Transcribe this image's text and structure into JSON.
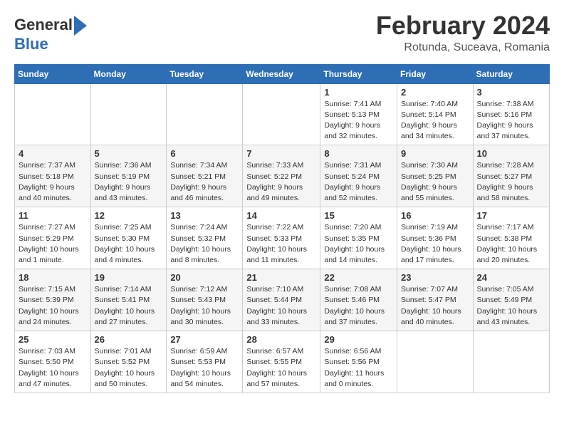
{
  "header": {
    "logo_general": "General",
    "logo_blue": "Blue",
    "month_title": "February 2024",
    "location": "Rotunda, Suceava, Romania"
  },
  "weekdays": [
    "Sunday",
    "Monday",
    "Tuesday",
    "Wednesday",
    "Thursday",
    "Friday",
    "Saturday"
  ],
  "weeks": [
    [
      {
        "day": "",
        "info": ""
      },
      {
        "day": "",
        "info": ""
      },
      {
        "day": "",
        "info": ""
      },
      {
        "day": "",
        "info": ""
      },
      {
        "day": "1",
        "info": "Sunrise: 7:41 AM\nSunset: 5:13 PM\nDaylight: 9 hours\nand 32 minutes."
      },
      {
        "day": "2",
        "info": "Sunrise: 7:40 AM\nSunset: 5:14 PM\nDaylight: 9 hours\nand 34 minutes."
      },
      {
        "day": "3",
        "info": "Sunrise: 7:38 AM\nSunset: 5:16 PM\nDaylight: 9 hours\nand 37 minutes."
      }
    ],
    [
      {
        "day": "4",
        "info": "Sunrise: 7:37 AM\nSunset: 5:18 PM\nDaylight: 9 hours\nand 40 minutes."
      },
      {
        "day": "5",
        "info": "Sunrise: 7:36 AM\nSunset: 5:19 PM\nDaylight: 9 hours\nand 43 minutes."
      },
      {
        "day": "6",
        "info": "Sunrise: 7:34 AM\nSunset: 5:21 PM\nDaylight: 9 hours\nand 46 minutes."
      },
      {
        "day": "7",
        "info": "Sunrise: 7:33 AM\nSunset: 5:22 PM\nDaylight: 9 hours\nand 49 minutes."
      },
      {
        "day": "8",
        "info": "Sunrise: 7:31 AM\nSunset: 5:24 PM\nDaylight: 9 hours\nand 52 minutes."
      },
      {
        "day": "9",
        "info": "Sunrise: 7:30 AM\nSunset: 5:25 PM\nDaylight: 9 hours\nand 55 minutes."
      },
      {
        "day": "10",
        "info": "Sunrise: 7:28 AM\nSunset: 5:27 PM\nDaylight: 9 hours\nand 58 minutes."
      }
    ],
    [
      {
        "day": "11",
        "info": "Sunrise: 7:27 AM\nSunset: 5:29 PM\nDaylight: 10 hours\nand 1 minute."
      },
      {
        "day": "12",
        "info": "Sunrise: 7:25 AM\nSunset: 5:30 PM\nDaylight: 10 hours\nand 4 minutes."
      },
      {
        "day": "13",
        "info": "Sunrise: 7:24 AM\nSunset: 5:32 PM\nDaylight: 10 hours\nand 8 minutes."
      },
      {
        "day": "14",
        "info": "Sunrise: 7:22 AM\nSunset: 5:33 PM\nDaylight: 10 hours\nand 11 minutes."
      },
      {
        "day": "15",
        "info": "Sunrise: 7:20 AM\nSunset: 5:35 PM\nDaylight: 10 hours\nand 14 minutes."
      },
      {
        "day": "16",
        "info": "Sunrise: 7:19 AM\nSunset: 5:36 PM\nDaylight: 10 hours\nand 17 minutes."
      },
      {
        "day": "17",
        "info": "Sunrise: 7:17 AM\nSunset: 5:38 PM\nDaylight: 10 hours\nand 20 minutes."
      }
    ],
    [
      {
        "day": "18",
        "info": "Sunrise: 7:15 AM\nSunset: 5:39 PM\nDaylight: 10 hours\nand 24 minutes."
      },
      {
        "day": "19",
        "info": "Sunrise: 7:14 AM\nSunset: 5:41 PM\nDaylight: 10 hours\nand 27 minutes."
      },
      {
        "day": "20",
        "info": "Sunrise: 7:12 AM\nSunset: 5:43 PM\nDaylight: 10 hours\nand 30 minutes."
      },
      {
        "day": "21",
        "info": "Sunrise: 7:10 AM\nSunset: 5:44 PM\nDaylight: 10 hours\nand 33 minutes."
      },
      {
        "day": "22",
        "info": "Sunrise: 7:08 AM\nSunset: 5:46 PM\nDaylight: 10 hours\nand 37 minutes."
      },
      {
        "day": "23",
        "info": "Sunrise: 7:07 AM\nSunset: 5:47 PM\nDaylight: 10 hours\nand 40 minutes."
      },
      {
        "day": "24",
        "info": "Sunrise: 7:05 AM\nSunset: 5:49 PM\nDaylight: 10 hours\nand 43 minutes."
      }
    ],
    [
      {
        "day": "25",
        "info": "Sunrise: 7:03 AM\nSunset: 5:50 PM\nDaylight: 10 hours\nand 47 minutes."
      },
      {
        "day": "26",
        "info": "Sunrise: 7:01 AM\nSunset: 5:52 PM\nDaylight: 10 hours\nand 50 minutes."
      },
      {
        "day": "27",
        "info": "Sunrise: 6:59 AM\nSunset: 5:53 PM\nDaylight: 10 hours\nand 54 minutes."
      },
      {
        "day": "28",
        "info": "Sunrise: 6:57 AM\nSunset: 5:55 PM\nDaylight: 10 hours\nand 57 minutes."
      },
      {
        "day": "29",
        "info": "Sunrise: 6:56 AM\nSunset: 5:56 PM\nDaylight: 11 hours\nand 0 minutes."
      },
      {
        "day": "",
        "info": ""
      },
      {
        "day": "",
        "info": ""
      }
    ]
  ]
}
